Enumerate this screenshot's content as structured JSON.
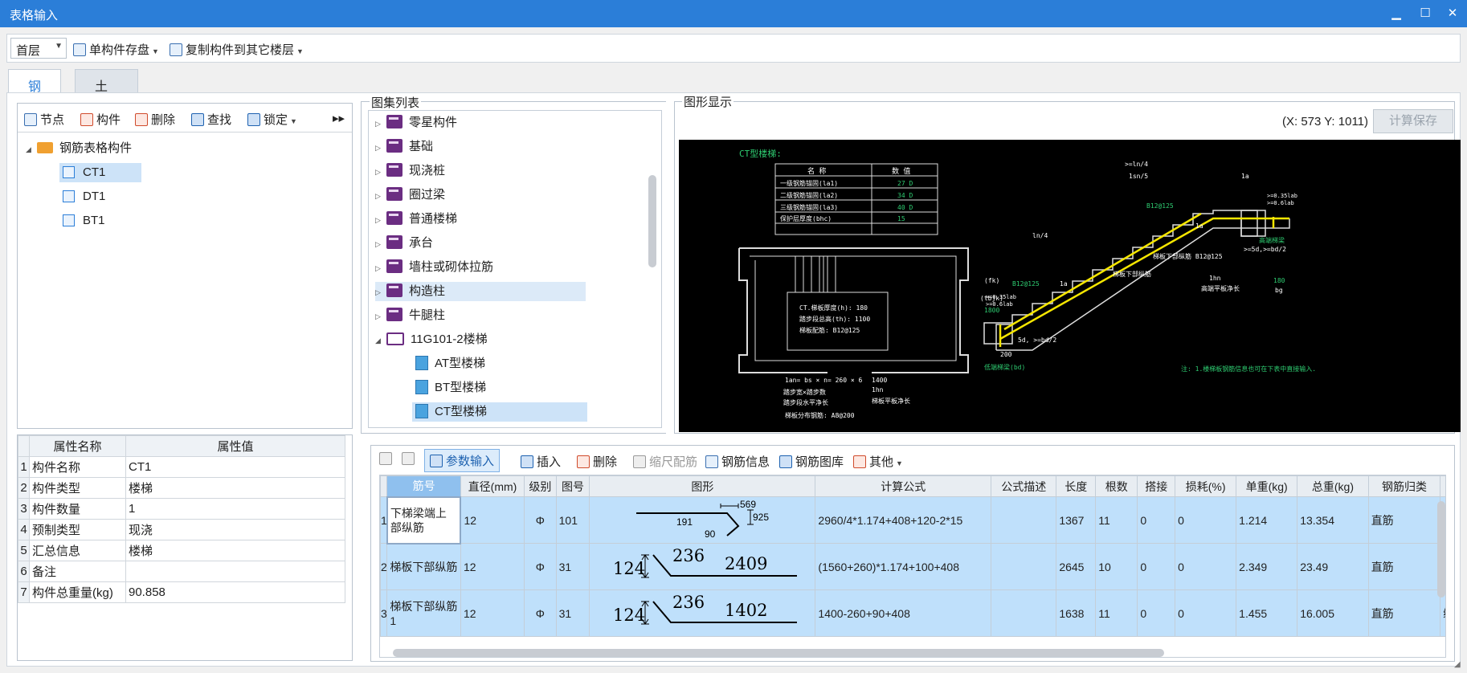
{
  "window": {
    "title": "表格输入",
    "controls": [
      "▁",
      "☐",
      "✕"
    ]
  },
  "toolbar": {
    "floor": "首层",
    "save_single": "单构件存盘",
    "copy_to_floor": "复制构件到其它楼层"
  },
  "tabs": [
    {
      "label": "钢筋",
      "active": true
    },
    {
      "label": "土建",
      "active": false
    }
  ],
  "left_toolbar": {
    "node": "节点",
    "component": "构件",
    "delete": "删除",
    "find": "查找",
    "lock": "锁定",
    "more": "▸▸"
  },
  "tree": {
    "root": "钢筋表格构件",
    "children": [
      "CT1",
      "DT1",
      "BT1"
    ],
    "selected": "CT1"
  },
  "properties": {
    "headers": [
      "属性名称",
      "属性值"
    ],
    "rows": [
      {
        "num": "1",
        "name": "构件名称",
        "value": "CT1"
      },
      {
        "num": "2",
        "name": "构件类型",
        "value": "楼梯"
      },
      {
        "num": "3",
        "name": "构件数量",
        "value": "1"
      },
      {
        "num": "4",
        "name": "预制类型",
        "value": "现浇"
      },
      {
        "num": "5",
        "name": "汇总信息",
        "value": "楼梯"
      },
      {
        "num": "6",
        "name": "备注",
        "value": ""
      },
      {
        "num": "7",
        "name": "构件总重量(kg)",
        "value": "90.858"
      }
    ]
  },
  "atlas": {
    "title": "图集列表",
    "items": [
      "零星构件",
      "基础",
      "现浇桩",
      "圈过梁",
      "普通楼梯",
      "承台",
      "墙柱或砌体拉筋",
      "构造柱",
      "牛腿柱"
    ],
    "highlighted": "构造柱",
    "expanded": {
      "label": "11G101-2楼梯",
      "children": [
        "AT型楼梯",
        "BT型楼梯",
        "CT型楼梯"
      ],
      "selected": "CT型楼梯"
    }
  },
  "display": {
    "title": "图形显示",
    "coord": "(X: 573 Y: 1011)",
    "calc_save": "计算保存",
    "drawing": {
      "heading": "CT型楼梯:",
      "table_headers": [
        "名 称",
        "数 值"
      ],
      "table_rows": [
        [
          "一级钢筋锚固(la1)",
          "27 D"
        ],
        [
          "二级钢筋锚固(la2)",
          "34 D"
        ],
        [
          "三级钢筋锚固(la3)",
          "40 D"
        ],
        [
          "保护层厚度(bhc)",
          "15"
        ]
      ],
      "plan_notes": [
        "CT.梯板厚度(h): 180",
        "踏步段总高(th): 1100",
        "梯板配筋: B12@125"
      ],
      "bottom_notes": [
        "1an= bs × n= 260 × 6",
        "1400",
        "踏步宽×踏步数",
        "1hn",
        "踏步段水平净长",
        "梯板平板净长",
        "梯板分布钢筋: A8@200"
      ],
      "side_labels": [
        "(fk)",
        "(tbjk)",
        "1800"
      ],
      "sec_labels": [
        ">=ln/4",
        "1sn/5",
        "1a",
        ">=0.35lab",
        ">=0.6lab",
        "B12@125",
        "ln/4",
        "高端梯梁",
        "梯板下部纵筋 B12@125",
        ">=5d,>=bd/2",
        "1hn",
        "180",
        "高端平板净长",
        "bg",
        "梯板下部纵筋",
        ">=0.35lab",
        ">=0.6lab",
        "B12@125",
        "1a",
        "1a",
        "5d, >=bd/2",
        "200",
        "低端梯梁(bd)"
      ],
      "note": "注: 1.楼梯板钢筋信息也可在下表中直接输入."
    }
  },
  "grid_toolbar": [
    "参数输入",
    "插入",
    "删除",
    "缩尺配筋",
    "钢筋信息",
    "钢筋图库",
    "其他"
  ],
  "grid": {
    "headers": [
      "筋号",
      "直径(mm)",
      "级别",
      "图号",
      "图形",
      "计算公式",
      "公式描述",
      "长度",
      "根数",
      "搭接",
      "损耗(%)",
      "单重(kg)",
      "总重(kg)",
      "钢筋归类",
      "搭"
    ],
    "rows": [
      {
        "num": "1",
        "name": "下梯梁端上部纵筋",
        "dia": "12",
        "grade": "Φ",
        "fig": "101",
        "shape": {
          "a": "569",
          "b": "925",
          "c": "191",
          "d": "90"
        },
        "formula": "2960/4*1.174+408+120-2*15",
        "desc": "",
        "len": "1367",
        "count": "11",
        "lap": "0",
        "loss": "0",
        "unit": "1.214",
        "total": "13.354",
        "cat": "直筋",
        "tie": "绑扎"
      },
      {
        "num": "2",
        "name": "梯板下部纵筋",
        "dia": "12",
        "grade": "Φ",
        "fig": "31",
        "shape": {
          "a": "124",
          "b": "236",
          "c": "2409"
        },
        "formula": "(1560+260)*1.174+100+408",
        "desc": "",
        "len": "2645",
        "count": "10",
        "lap": "0",
        "loss": "0",
        "unit": "2.349",
        "total": "23.49",
        "cat": "直筋",
        "tie": "绑扎"
      },
      {
        "num": "3",
        "name": "梯板下部纵筋1",
        "dia": "12",
        "grade": "Φ",
        "fig": "31",
        "shape": {
          "a": "124",
          "b": "236",
          "c": "1402"
        },
        "formula": "1400-260+90+408",
        "desc": "",
        "len": "1638",
        "count": "11",
        "lap": "0",
        "loss": "0",
        "unit": "1.455",
        "total": "16.005",
        "cat": "直筋",
        "tie": "绑扎"
      }
    ]
  }
}
